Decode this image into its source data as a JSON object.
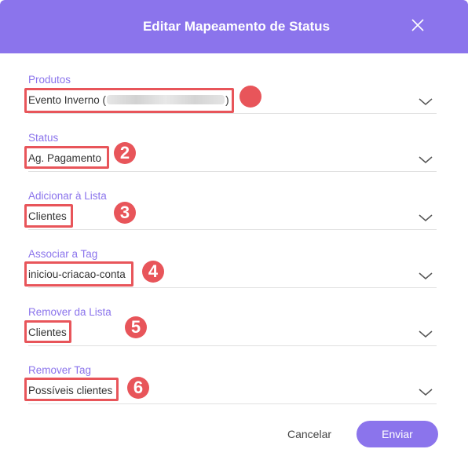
{
  "modal": {
    "title": "Editar Mapeamento de Status",
    "close_icon": "close-icon",
    "accent_color": "#8b74ec"
  },
  "fields": [
    {
      "label": "Produtos",
      "value_prefix": "Evento Inverno (",
      "value_suffix": ")",
      "icon": "chevron-down-icon"
    },
    {
      "label": "Status",
      "value": "Ag. Pagamento",
      "icon": "chevron-down-icon"
    },
    {
      "label": "Adicionar à Lista",
      "value": "Clientes",
      "icon": "chevron-down-icon"
    },
    {
      "label": "Associar a Tag",
      "value": "iniciou-criacao-conta",
      "icon": "chevron-down-icon"
    },
    {
      "label": "Remover da Lista",
      "value": "Clientes",
      "icon": "chevron-down-icon"
    },
    {
      "label": "Remover Tag",
      "value": "Possíveis clientes",
      "icon": "chevron-down-icon"
    }
  ],
  "annotations": {
    "color": "#e8555a",
    "badges": [
      "",
      "2",
      "3",
      "4",
      "5",
      "6"
    ]
  },
  "footer": {
    "cancel_label": "Cancelar",
    "send_label": "Enviar"
  }
}
